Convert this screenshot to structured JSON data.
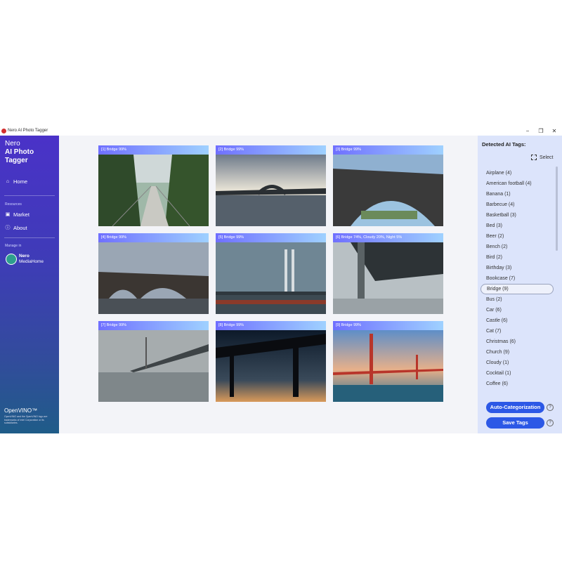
{
  "window": {
    "title": "Nero AI Photo Tagger",
    "controls": {
      "minimize": "−",
      "maximize": "❐",
      "close": "✕"
    }
  },
  "sidebar": {
    "brand_line1": "Nero",
    "brand_line2": "AI Photo",
    "brand_line3": "Tagger",
    "home_label": "Home",
    "resources_label": "Resources",
    "market_label": "Market",
    "about_label": "About",
    "manage_label": "Manage in",
    "mediahome_line1": "Nero",
    "mediahome_line2": "MediaHome",
    "openvino": "OpenVINO™",
    "legal": "OpenVINO and the OpenVINO logo are trademarks of Intel Corporation or its subsidiaries."
  },
  "photos": [
    {
      "caption": "[1] Bridge 99%"
    },
    {
      "caption": "[2] Bridge 99%"
    },
    {
      "caption": "[3] Bridge 99%"
    },
    {
      "caption": "[4] Bridge 99%"
    },
    {
      "caption": "[5] Bridge 99%"
    },
    {
      "caption": "[6] Bridge 74%, Cloudy 20%, Night 5%"
    },
    {
      "caption": "[7] Bridge 99%"
    },
    {
      "caption": "[8] Bridge 99%"
    },
    {
      "caption": "[9] Bridge 99%"
    }
  ],
  "right_panel": {
    "title": "Detected AI Tags:",
    "select_label": "Select",
    "tags": [
      "Airplane (4)",
      "American football (4)",
      "Banana (1)",
      "Barbecue (4)",
      "Basketball (3)",
      "Bed (3)",
      "Beer (2)",
      "Bench (2)",
      "Bird (2)",
      "Birthday (3)",
      "Bookcase (7)",
      "Bridge (9)",
      "Bus (2)",
      "Car (6)",
      "Castle (6)",
      "Cat (7)",
      "Christmas (6)",
      "Church (9)",
      "Cloudy (1)",
      "Cocktail (1)",
      "Coffee (6)"
    ],
    "selected_tag": "Bridge (9)",
    "auto_button": "Auto-Categorization",
    "save_button": "Save Tags",
    "help": "?"
  },
  "colors": {
    "accent": "#2c58e6",
    "sidebar_top": "#4a32c8",
    "sidebar_bottom": "#1f5c88"
  }
}
